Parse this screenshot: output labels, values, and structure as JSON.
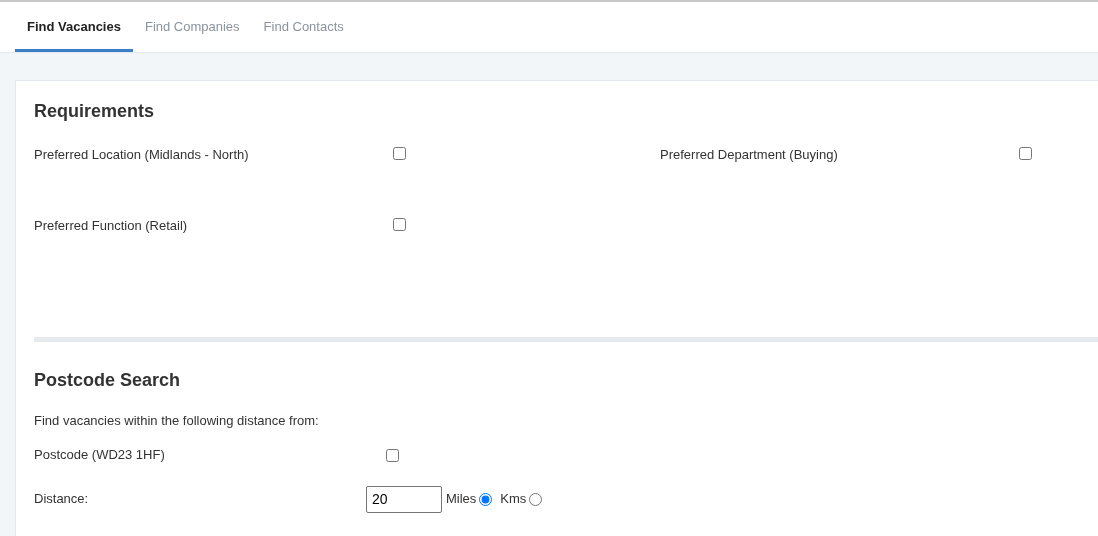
{
  "tabs": [
    {
      "label": "Find Vacancies",
      "selected": true
    },
    {
      "label": "Find Companies",
      "selected": false
    },
    {
      "label": "Find Contacts",
      "selected": false
    }
  ],
  "requirements": {
    "title": "Requirements",
    "items": [
      {
        "label": "Preferred Location (Midlands - North)",
        "checked": false
      },
      {
        "label": "Preferred Department (Buying)",
        "checked": false
      },
      {
        "label": "Preferred Function (Retail)",
        "checked": false
      }
    ]
  },
  "postcode_search": {
    "title": "Postcode Search",
    "intro": "Find vacancies within the following distance from:",
    "postcode": {
      "label": "Postcode (WD23 1HF)",
      "checked": false
    },
    "distance": {
      "label": "Distance:",
      "value": "20",
      "units": [
        {
          "label": "Miles",
          "selected": true
        },
        {
          "label": "Kms",
          "selected": false
        }
      ]
    }
  }
}
